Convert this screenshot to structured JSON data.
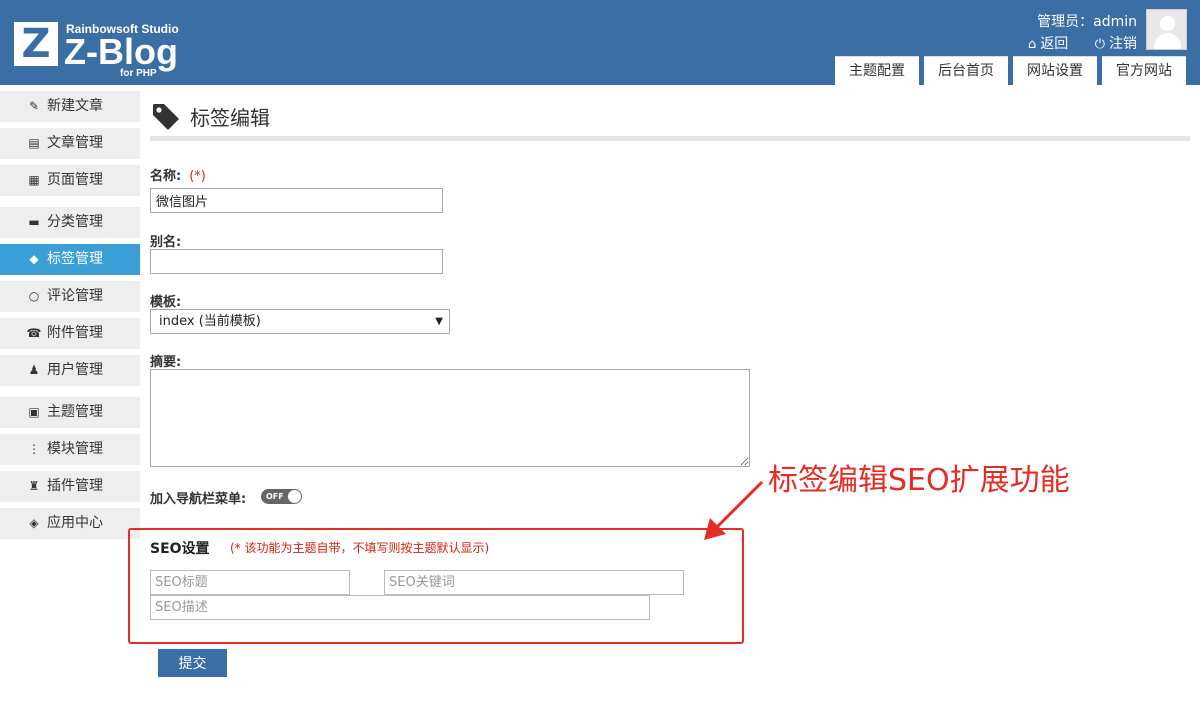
{
  "brand": {
    "studio": "Rainbowsoft Studio",
    "name": "Z-Blog",
    "sub": "for PHP",
    "mark": "Z"
  },
  "user": {
    "label": "管理员：admin",
    "back": "返回",
    "logout": "注销"
  },
  "top_tabs": [
    "主题配置",
    "后台首页",
    "网站设置",
    "官方网站"
  ],
  "sidebar": [
    {
      "label": "新建文章",
      "icon": "edit-icon"
    },
    {
      "label": "文章管理",
      "icon": "article-icon"
    },
    {
      "label": "页面管理",
      "icon": "pages-icon"
    },
    {
      "label": "分类管理",
      "icon": "folder-icon"
    },
    {
      "label": "标签管理",
      "icon": "tag-icon",
      "active": true
    },
    {
      "label": "评论管理",
      "icon": "comment-icon"
    },
    {
      "label": "附件管理",
      "icon": "attachment-icon"
    },
    {
      "label": "用户管理",
      "icon": "user-icon"
    },
    {
      "label": "主题管理",
      "icon": "theme-icon"
    },
    {
      "label": "模块管理",
      "icon": "module-icon"
    },
    {
      "label": "插件管理",
      "icon": "plugin-icon"
    },
    {
      "label": "应用中心",
      "icon": "app-center-icon"
    }
  ],
  "page": {
    "title": "标签编辑"
  },
  "form": {
    "name_label": "名称:",
    "required_mark": "(*)",
    "name_value": "微信图片",
    "alias_label": "别名:",
    "alias_value": "",
    "template_label": "模板:",
    "template_value": "index (当前模板)",
    "summary_label": "摘要:",
    "nav_label": "加入导航栏菜单:",
    "nav_toggle": "OFF",
    "seo_title": "SEO设置",
    "seo_note": "(* 该功能为主题自带，不填写则按主题默认显示)",
    "seo_title_placeholder": "SEO标题",
    "seo_keywords_placeholder": "SEO关键词",
    "seo_desc_placeholder": "SEO描述",
    "submit": "提交"
  },
  "annotation": "标签编辑SEO扩展功能",
  "colors": {
    "header": "#3a6ea5",
    "active": "#3a9fd6",
    "annotation": "#e52c25"
  }
}
